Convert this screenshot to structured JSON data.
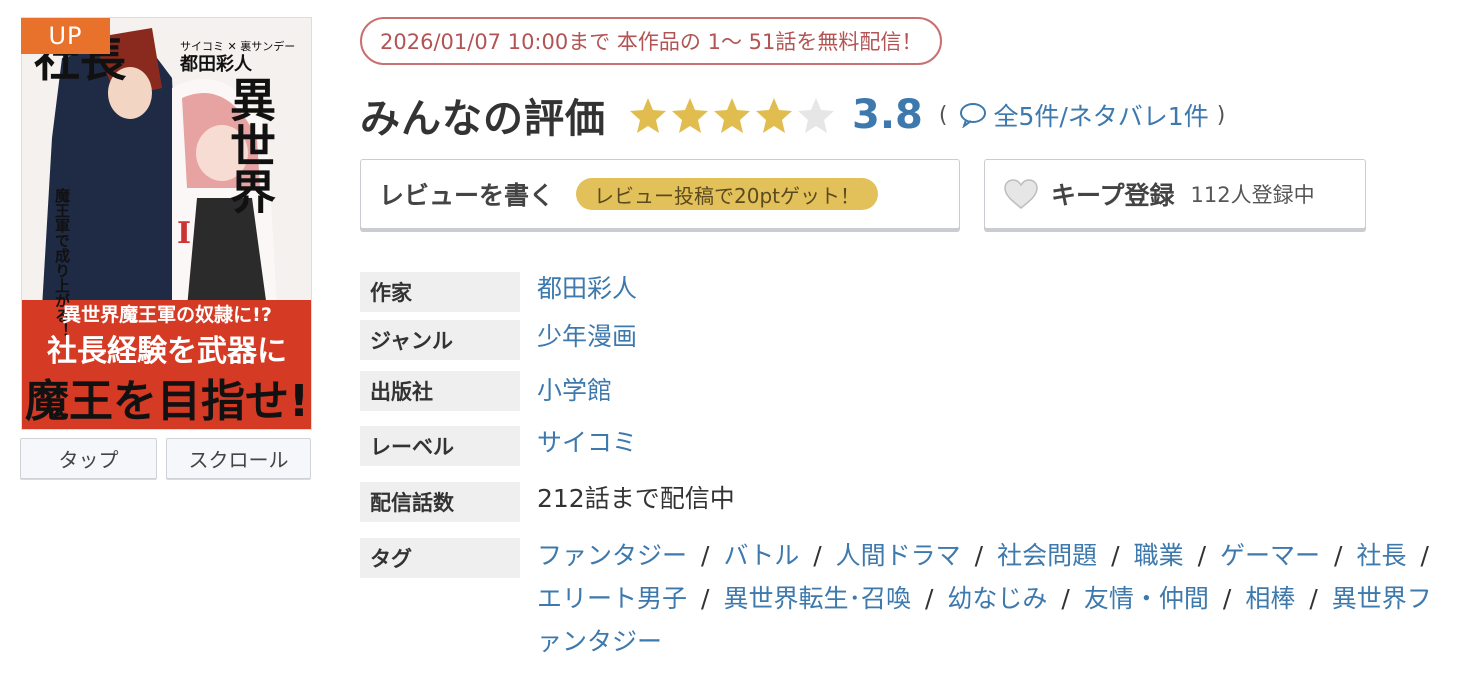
{
  "cover": {
    "badge": "UP",
    "title_main": "異世界社長",
    "title_vertical_right": "異世界",
    "title_vertical_left": "社長",
    "subtitle_vertical": "魔王軍で成り上がる！",
    "credit_small": "サイコミ ✕ 裏サンデー",
    "author_on_cover": "都田彩人",
    "volume": "Ⅰ",
    "tagline_1": "異世界魔王軍の奴隷に!?",
    "tagline_2": "社長経験を武器に",
    "tagline_3": "魔王を目指せ!",
    "tap_label": "タップ",
    "scroll_label": "スクロール"
  },
  "campaign": {
    "text": "2026/01/07 10:00まで 本作品の 1〜 51話を無料配信！"
  },
  "rating": {
    "title": "みんなの評価",
    "score": "3.8",
    "stars_filled": 4,
    "stars_total": 5,
    "open_paren": "(",
    "close_paren": ")",
    "reviews_text": "全5件/ネタバレ1件"
  },
  "review_button": {
    "label": "レビューを書く",
    "badge": "レビュー投稿で20ptゲット！"
  },
  "keep_button": {
    "label": "キープ登録",
    "count": "112人登録中"
  },
  "info": {
    "author": {
      "label": "作家",
      "value": "都田彩人"
    },
    "genre": {
      "label": "ジャンル",
      "value": "少年漫画"
    },
    "publisher": {
      "label": "出版社",
      "value": "小学館"
    },
    "label": {
      "label": "レーベル",
      "value": "サイコミ"
    },
    "episodes": {
      "label": "配信話数",
      "value": "212話まで配信中"
    },
    "tags": {
      "label": "タグ",
      "items": [
        "ファンタジー",
        "バトル",
        "人間ドラマ",
        "社会問題",
        "職業",
        "ゲーマー",
        "社長",
        "エリート男子",
        "異世界転生･召喚",
        "幼なじみ",
        "友情・仲間",
        "相棒",
        "異世界ファンタジー"
      ],
      "separator": "/"
    }
  },
  "colors": {
    "accent_blue": "#3d79ad",
    "star_gold": "#e1bd4f",
    "star_empty": "#e6e6e6",
    "campaign_red": "#c97070",
    "badge_orange": "#e8712b",
    "point_badge_gold": "#e3c15a"
  }
}
